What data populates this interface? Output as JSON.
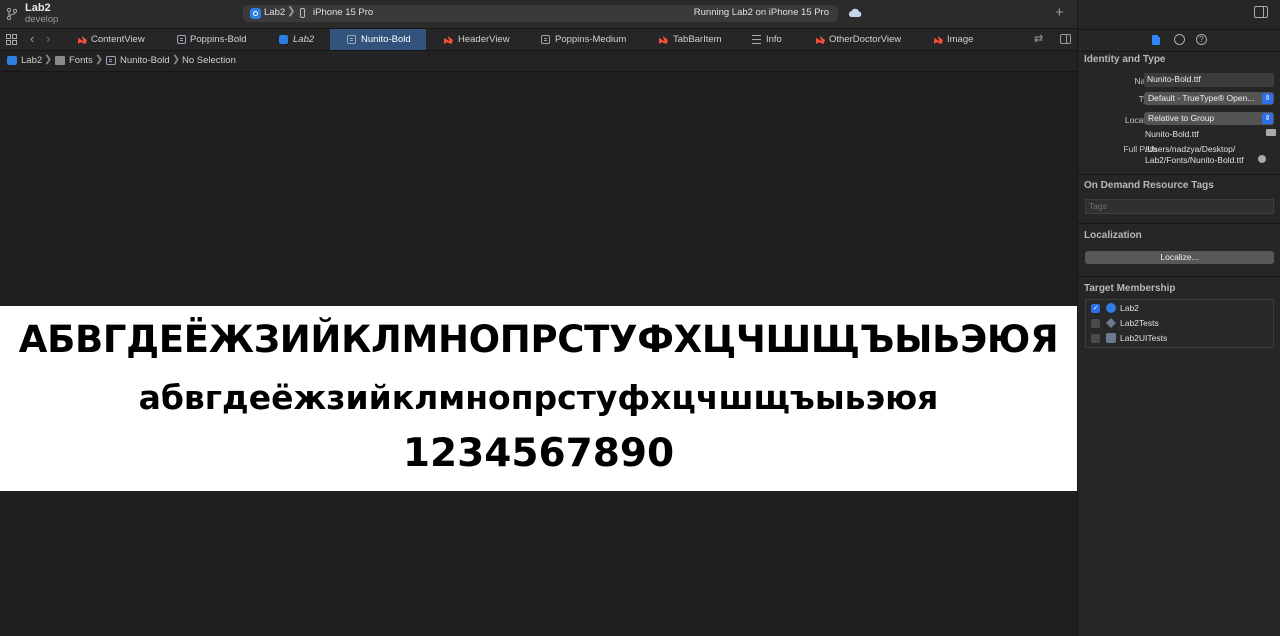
{
  "toolbar": {
    "project": "Lab2",
    "branch": "develop",
    "scheme_app": "Lab2",
    "scheme_device": "iPhone 15 Pro",
    "status": "Running Lab2 on iPhone 15 Pro",
    "add_tab": "+"
  },
  "tabs": [
    {
      "label": "ContentView",
      "icon": "swift-file-icon"
    },
    {
      "label": "Poppins-Bold",
      "icon": "font-file-icon"
    },
    {
      "label": "Lab2",
      "icon": "app-icon",
      "italic": true
    },
    {
      "label": "Nunito-Bold",
      "icon": "font-file-icon",
      "active": true
    },
    {
      "label": "HeaderView",
      "icon": "swift-file-icon"
    },
    {
      "label": "Poppins-Medium",
      "icon": "font-file-icon"
    },
    {
      "label": "TabBarItem",
      "icon": "swift-file-icon"
    },
    {
      "label": "Info",
      "icon": "plist-icon"
    },
    {
      "label": "OtherDoctorView",
      "icon": "swift-file-icon"
    },
    {
      "label": "Image",
      "icon": "swift-file-icon"
    }
  ],
  "jumpbar": {
    "project": "Lab2",
    "folder": "Fonts",
    "file": "Nunito-Bold",
    "selection": "No Selection"
  },
  "preview": {
    "uppercase": "АБВГДЕЁЖЗИЙКЛМНОПРСТУФХЦЧШЩЪЫЬЭЮЯ",
    "lowercase": "абвгдеёжзийклмнопрстуфхцчшщъыьэюя",
    "digits": "1234567890"
  },
  "inspector": {
    "identity_title": "Identity and Type",
    "name_label": "Name",
    "name_value": "Nunito-Bold.ttf",
    "type_label": "Type",
    "type_value": "Default - TrueType® Open...",
    "location_label": "Location",
    "location_value": "Relative to Group",
    "location_file": "Nunito-Bold.ttf",
    "full_path_label": "Full Path",
    "full_path_line1": "/Users/nadzya/Desktop/",
    "full_path_line2": "Lab2/Fonts/Nunito-Bold.ttf",
    "odr_title": "On Demand Resource Tags",
    "tags_placeholder": "Tags",
    "localization_title": "Localization",
    "localize_button": "Localize...",
    "membership_title": "Target Membership",
    "targets": [
      {
        "name": "Lab2",
        "checked": true
      },
      {
        "name": "Lab2Tests",
        "checked": false
      },
      {
        "name": "Lab2UITests",
        "checked": false
      }
    ]
  },
  "colors": {
    "active_tab": "#31537c",
    "accent": "#2e6ee6",
    "editor_bg": "#1f1f1f"
  }
}
